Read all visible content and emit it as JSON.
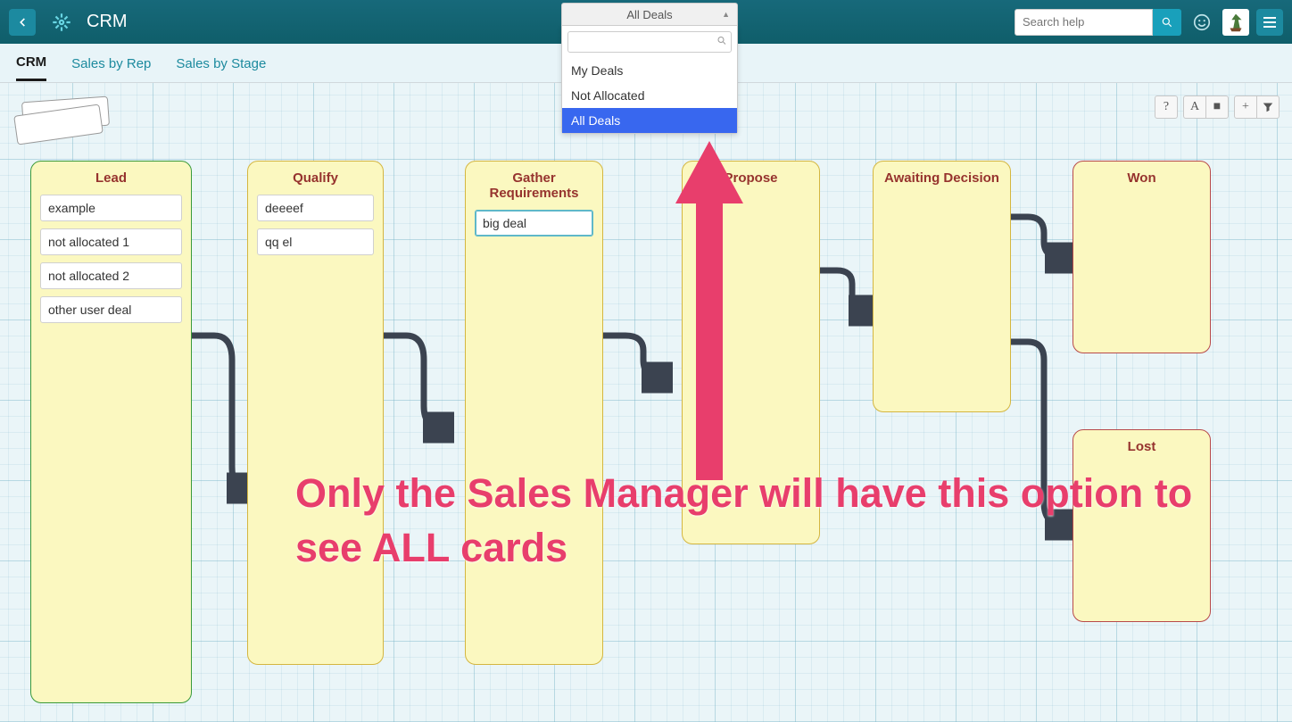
{
  "header": {
    "app_title": "CRM",
    "search_placeholder": "Search help"
  },
  "filter": {
    "selected": "All Deals",
    "options": [
      "My Deals",
      "Not Allocated",
      "All Deals"
    ],
    "selected_index": 2
  },
  "tabs": [
    {
      "label": "CRM",
      "active": true
    },
    {
      "label": "Sales by Rep",
      "active": false
    },
    {
      "label": "Sales by Stage",
      "active": false
    }
  ],
  "columns": {
    "lead": {
      "title": "Lead",
      "cards": [
        "example",
        "not allocated 1",
        "not allocated 2",
        "other user deal"
      ]
    },
    "qualify": {
      "title": "Qualify",
      "cards": [
        "deeeef",
        "qq el"
      ]
    },
    "gather": {
      "title": "Gather Requirements",
      "cards": [
        "big deal"
      ]
    },
    "propose": {
      "title": "Propose",
      "cards": []
    },
    "await": {
      "title": "Awaiting Decision",
      "cards": []
    },
    "won": {
      "title": "Won",
      "cards": []
    },
    "lost": {
      "title": "Lost",
      "cards": []
    }
  },
  "toolbar": {
    "help": "?",
    "font": "A",
    "block": "■",
    "plus": "+",
    "filter": "▼"
  },
  "annotation": "Only the Sales Manager will have this option to see ALL cards"
}
